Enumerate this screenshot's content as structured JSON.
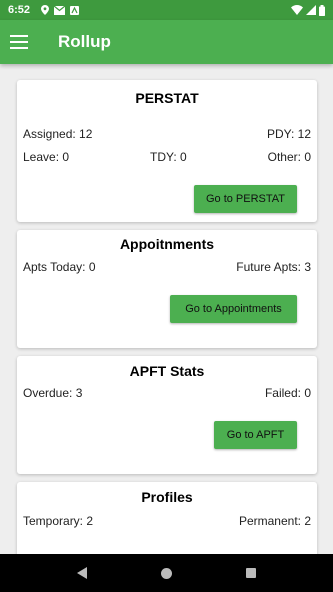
{
  "status_bar": {
    "time": "6:52"
  },
  "app_bar": {
    "title": "Rollup"
  },
  "perstat": {
    "title": "PERSTAT",
    "assigned": "Assigned: 12",
    "pdy": "PDY: 12",
    "leave": "Leave: 0",
    "tdy": "TDY: 0",
    "other": "Other: 0",
    "button": "Go to PERSTAT"
  },
  "appointments": {
    "title": "Appoitnments",
    "today": "Apts Today: 0",
    "future": "Future Apts: 3",
    "button": "Go to Appointments"
  },
  "apft": {
    "title": "APFT Stats",
    "overdue": "Overdue: 3",
    "failed": "Failed: 0",
    "button": "Go to APFT"
  },
  "profiles": {
    "title": "Profiles",
    "temporary": "Temporary: 2",
    "permanent": "Permanent: 2"
  },
  "colors": {
    "primary": "#4caf50",
    "status_bar": "#3e9a3e",
    "background": "#eeeeee"
  }
}
